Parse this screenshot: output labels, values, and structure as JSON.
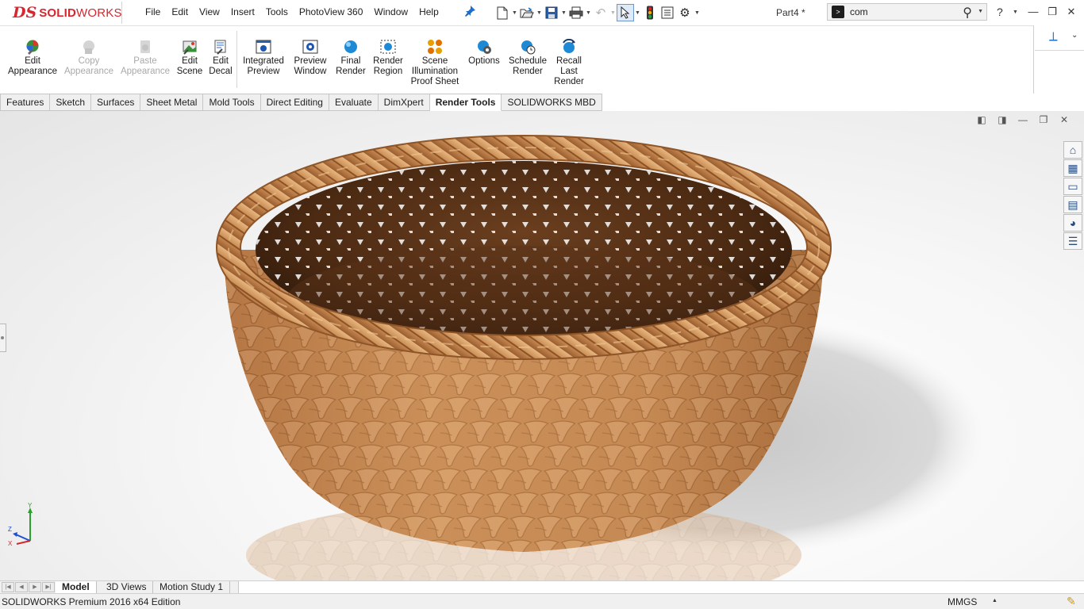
{
  "app": {
    "logo_ds": "DS",
    "logo_word_bold": "SOLID",
    "logo_word_light": "WORKS"
  },
  "menu": [
    "File",
    "Edit",
    "View",
    "Insert",
    "Tools",
    "PhotoView 360",
    "Window",
    "Help"
  ],
  "document": {
    "title": "Part4 *"
  },
  "search": {
    "value": "com"
  },
  "commands": [
    {
      "line1": "Edit",
      "line2": "Appearance",
      "line3": "",
      "enabled": true,
      "icon": "edit-appearance-icon"
    },
    {
      "line1": "Copy",
      "line2": "Appearance",
      "line3": "",
      "enabled": false,
      "icon": "copy-appearance-icon"
    },
    {
      "line1": "Paste",
      "line2": "Appearance",
      "line3": "",
      "enabled": false,
      "icon": "paste-appearance-icon"
    },
    {
      "line1": "Edit",
      "line2": "Scene",
      "line3": "",
      "enabled": true,
      "icon": "edit-scene-icon"
    },
    {
      "line1": "Edit",
      "line2": "Decal",
      "line3": "",
      "enabled": true,
      "icon": "edit-decal-icon"
    },
    {
      "line1": "Integrated",
      "line2": "Preview",
      "line3": "",
      "enabled": true,
      "icon": "integrated-preview-icon"
    },
    {
      "line1": "Preview",
      "line2": "Window",
      "line3": "",
      "enabled": true,
      "icon": "preview-window-icon"
    },
    {
      "line1": "Final",
      "line2": "Render",
      "line3": "",
      "enabled": true,
      "icon": "final-render-icon"
    },
    {
      "line1": "Render",
      "line2": "Region",
      "line3": "",
      "enabled": true,
      "icon": "render-region-icon"
    },
    {
      "line1": "Scene",
      "line2": "Illumination",
      "line3": "Proof Sheet",
      "enabled": true,
      "icon": "scene-illumination-icon"
    },
    {
      "line1": "Options",
      "line2": "",
      "line3": "",
      "enabled": true,
      "icon": "options-gear-icon"
    },
    {
      "line1": "Schedule",
      "line2": "Render",
      "line3": "",
      "enabled": true,
      "icon": "schedule-render-icon"
    },
    {
      "line1": "Recall",
      "line2": "Last",
      "line3": "Render",
      "enabled": true,
      "icon": "recall-render-icon"
    }
  ],
  "tabs": [
    {
      "label": "Features",
      "active": false
    },
    {
      "label": "Sketch",
      "active": false
    },
    {
      "label": "Surfaces",
      "active": false
    },
    {
      "label": "Sheet Metal",
      "active": false
    },
    {
      "label": "Mold Tools",
      "active": false
    },
    {
      "label": "Direct Editing",
      "active": false
    },
    {
      "label": "Evaluate",
      "active": false
    },
    {
      "label": "DimXpert",
      "active": false
    },
    {
      "label": "Render Tools",
      "active": true
    },
    {
      "label": "SOLIDWORKS MBD",
      "active": false
    }
  ],
  "bottom_tabs": [
    {
      "label": "Model",
      "active": true
    },
    {
      "label": "3D Views",
      "active": false
    },
    {
      "label": "Motion Study 1",
      "active": false
    }
  ],
  "status": {
    "edition": "SOLIDWORKS Premium 2016 x64 Edition",
    "units": "MMGS"
  },
  "triad": {
    "y": "Y",
    "z": "Z",
    "x": "X"
  },
  "colors": {
    "brand": "#d8262e",
    "basket": "#c98d57",
    "accent": "#1b6fc8"
  }
}
